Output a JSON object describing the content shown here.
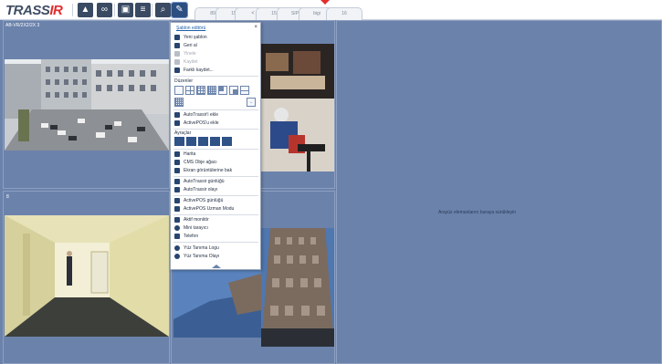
{
  "app": {
    "logo_main": "TRASS",
    "logo_accent": "IR"
  },
  "tabs": [
    "89",
    "15",
    "15",
    "SIP",
    "bigi",
    "16"
  ],
  "panes": {
    "top_left_label": "AB-VR/2X2/2X 3",
    "bottom_left_label": "8"
  },
  "drop_hint": "Arayüz elemanlarını buraya sürükleyin",
  "menu": {
    "title": "Şablon editörü",
    "close": "×",
    "items_top": [
      {
        "label": "Yeni şablon",
        "disabled": false,
        "icon": "new-template-icon"
      },
      {
        "label": "Geri al",
        "disabled": false,
        "icon": "undo-icon"
      },
      {
        "label": "Yinele",
        "disabled": true,
        "icon": "redo-icon"
      },
      {
        "label": "Kaydet",
        "disabled": true,
        "icon": "save-icon"
      },
      {
        "label": "Farklı kaydet...",
        "disabled": false,
        "icon": "save-as-icon"
      }
    ],
    "layouts_label": "Düzenler",
    "items_mid": [
      {
        "label": "AutoTrassir'i ekle",
        "icon": "plus-icon"
      },
      {
        "label": "ActivePOS'u ekle",
        "icon": "plus-icon"
      }
    ],
    "split_label": "Ayraçlar",
    "items_bottom": [
      {
        "label": "Harita",
        "icon": "map-icon"
      },
      {
        "label": "CMS Obje ağacı",
        "icon": "tree-icon"
      },
      {
        "label": "Ekran görüntülerine bak",
        "icon": "screenshot-icon"
      },
      {
        "label": "AutoTrassir günlüğü",
        "icon": "car-icon"
      },
      {
        "label": "AutoTrassir olayı",
        "icon": "car-icon"
      },
      {
        "label": "ActivePOS günlüğü",
        "icon": "pos-icon"
      },
      {
        "label": "ActivePOS Uzman Modu",
        "icon": "pos-expert-icon"
      },
      {
        "label": "Aktif monitör",
        "icon": "monitor-icon"
      },
      {
        "label": "Mini tarayıcı",
        "icon": "browser-icon"
      },
      {
        "label": "Telefon",
        "icon": "phone-icon"
      },
      {
        "label": "Yüz Tanıma Logu",
        "icon": "face-icon"
      },
      {
        "label": "Yüz Tanıma Olayı",
        "icon": "face-icon"
      }
    ]
  },
  "colors": {
    "background": "#6b82ab",
    "accent": "#e32d2d",
    "toolbar_button": "#3a4a63"
  }
}
